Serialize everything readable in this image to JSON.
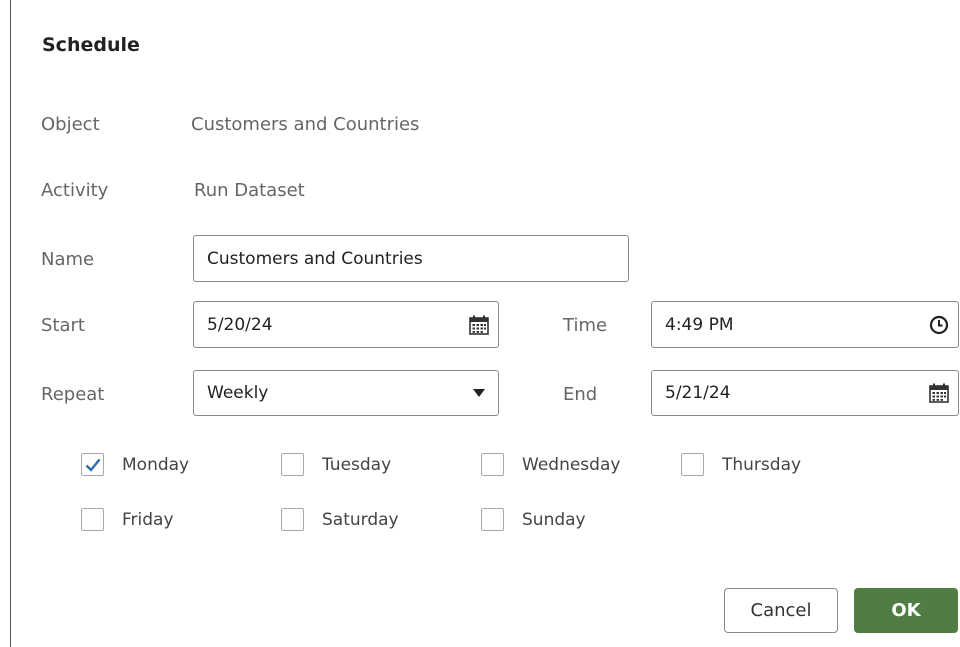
{
  "dialog": {
    "title": "Schedule",
    "object": {
      "label": "Object",
      "value": "Customers and Countries"
    },
    "activity": {
      "label": "Activity",
      "value": "Run Dataset"
    },
    "name": {
      "label": "Name",
      "value": "Customers and Countries"
    },
    "start": {
      "label": "Start",
      "value": "5/20/24",
      "icon": "calendar-icon"
    },
    "time": {
      "label": "Time",
      "value": "4:49 PM",
      "icon": "clock-icon"
    },
    "repeat": {
      "label": "Repeat",
      "value": "Weekly",
      "icon": "chevron-down-icon"
    },
    "end": {
      "label": "End",
      "value": "5/21/24",
      "icon": "calendar-icon"
    },
    "days": [
      {
        "label": "Monday",
        "checked": true
      },
      {
        "label": "Tuesday",
        "checked": false
      },
      {
        "label": "Wednesday",
        "checked": false
      },
      {
        "label": "Thursday",
        "checked": false
      },
      {
        "label": "Friday",
        "checked": false
      },
      {
        "label": "Saturday",
        "checked": false
      },
      {
        "label": "Sunday",
        "checked": false
      }
    ],
    "buttons": {
      "cancel": "Cancel",
      "ok": "OK"
    },
    "colors": {
      "ok_button": "#4f7d44",
      "checkmark": "#2b6cb0"
    }
  }
}
